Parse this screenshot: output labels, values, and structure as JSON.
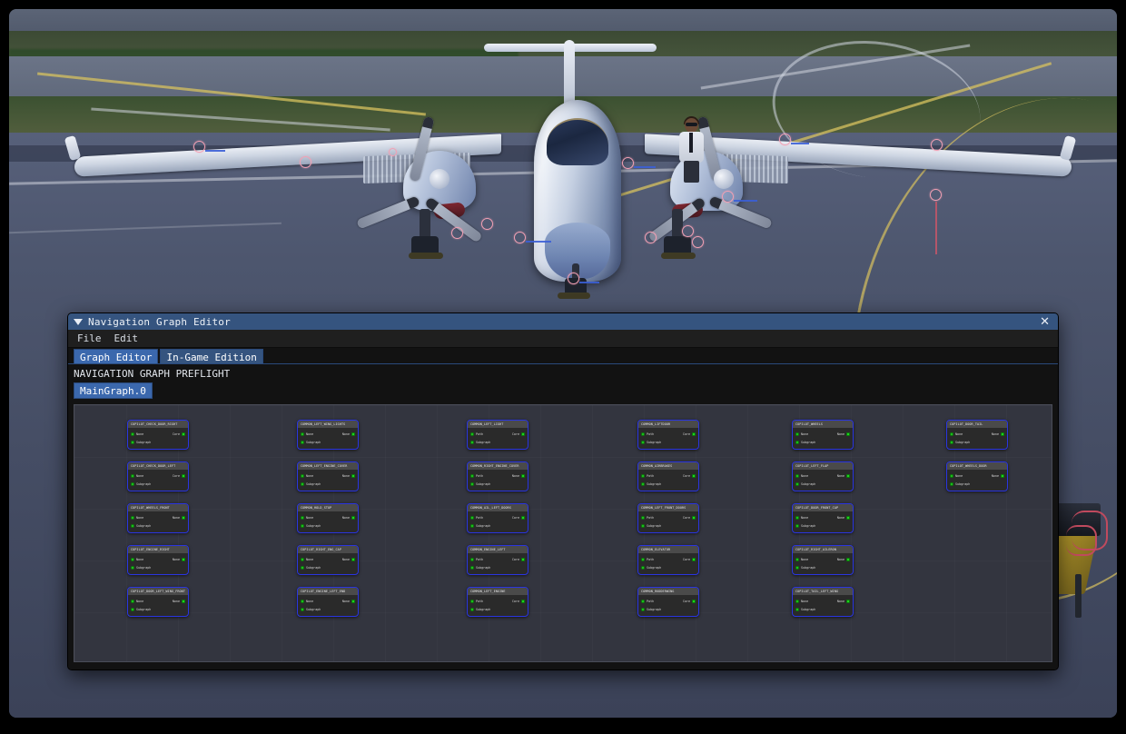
{
  "scene": {
    "description": "Microsoft Flight Simulator — twin turboprop aircraft on apron with preflight inspection markers",
    "aircraft": "twin-turboprop",
    "ground_crew": "pilot-figure",
    "ground_equipment": "gpu-cart"
  },
  "window": {
    "title": "Navigation Graph Editor",
    "collapse_icon": "triangle-down-icon",
    "close_icon": "close-icon",
    "close_label": "✕"
  },
  "menubar": {
    "items": [
      {
        "label": "File"
      },
      {
        "label": "Edit"
      }
    ]
  },
  "tabs": [
    {
      "label": "Graph Editor",
      "active": true
    },
    {
      "label": "In-Game Edition",
      "active": false
    }
  ],
  "graph_header": "NAVIGATION GRAPH PREFLIGHT",
  "graph_tabs": [
    {
      "label": "MainGraph.0",
      "active": true
    }
  ],
  "colors": {
    "titlebar": "#35547f",
    "tab_active": "#3b68ad",
    "canvas_bg": "#33353f",
    "node_border": "#2a35e0",
    "node_header": "#4a4a4a",
    "port_green": "#1fd21f",
    "window_bg": "#1c1c1c"
  },
  "canvas": {
    "columns": 6,
    "rows": 5,
    "node_rows": [
      {
        "nodes": [
          {
            "title": "COPILOT_CHECK_DOOR_RIGHT",
            "in_port": "exec",
            "in_label": "None",
            "out_label": "Core",
            "out_port": "exec",
            "sub_label": "Subgraph"
          },
          {
            "title": "COMMON_LEFT_WING_LIGHTS",
            "in_port": "exec",
            "in_label": "None",
            "out_label": "None",
            "out_port": "exec",
            "sub_label": "Subgraph"
          },
          {
            "title": "COMMON_LEFT_LIGHT",
            "in_port": "exec",
            "in_label": "Path",
            "out_label": "Core",
            "out_port": "exec",
            "sub_label": "Subgraph"
          },
          {
            "title": "COMMON_LIFTDOOR",
            "in_port": "exec",
            "in_label": "Path",
            "out_label": "Core",
            "out_port": "exec",
            "sub_label": "Subgraph"
          },
          {
            "title": "COPILOT_WHEELS",
            "in_port": "exec",
            "in_label": "None",
            "out_label": "None",
            "out_port": "exec",
            "sub_label": "Subgraph"
          },
          {
            "title": "COPILOT_DOOR_TAIL",
            "in_port": "exec",
            "in_label": "None",
            "out_label": "None",
            "out_port": "exec",
            "sub_label": "Subgraph"
          }
        ]
      },
      {
        "nodes": [
          {
            "title": "COPILOT_CHECK_DOOR_LEFT",
            "in_port": "exec",
            "in_label": "None",
            "out_label": "Core",
            "out_port": "exec",
            "sub_label": "Subgraph"
          },
          {
            "title": "COMMON_LEFT_ENGINE_COVER",
            "in_port": "exec",
            "in_label": "None",
            "out_label": "None",
            "out_port": "exec",
            "sub_label": "Subgraph"
          },
          {
            "title": "COMMON_RIGHT_ENGINE_COVER",
            "in_port": "exec",
            "in_label": "Path",
            "out_label": "None",
            "out_port": "exec",
            "sub_label": "Subgraph"
          },
          {
            "title": "COMMON_AIRBRAKES",
            "in_port": "exec",
            "in_label": "Path",
            "out_label": "Core",
            "out_port": "exec",
            "sub_label": "Subgraph"
          },
          {
            "title": "COPILOT_LEFT_FLAP",
            "in_port": "exec",
            "in_label": "None",
            "out_label": "None",
            "out_port": "exec",
            "sub_label": "Subgraph"
          },
          {
            "title": "COPILOT_WHEELS_DOOR",
            "in_port": "exec",
            "in_label": "None",
            "out_label": "None",
            "out_port": "exec",
            "sub_label": "Subgraph"
          }
        ]
      },
      {
        "nodes": [
          {
            "title": "COPILOT_WHEELS_FRONT",
            "in_port": "exec",
            "in_label": "None",
            "out_label": "None",
            "out_port": "exec",
            "sub_label": "Subgraph"
          },
          {
            "title": "COMMON_HOLD_STOP",
            "in_port": "exec",
            "in_label": "None",
            "out_label": "None",
            "out_port": "exec",
            "sub_label": "Subgraph"
          },
          {
            "title": "COMMON_AIL_LEFT_DOORS",
            "in_port": "exec",
            "in_label": "Path",
            "out_label": "Core",
            "out_port": "exec",
            "sub_label": "Subgraph"
          },
          {
            "title": "COMMON_LEFT_FRONT_DOORS",
            "in_port": "exec",
            "in_label": "Path",
            "out_label": "Core",
            "out_port": "exec",
            "sub_label": "Subgraph"
          },
          {
            "title": "COPILOT_DOOR_FRONT_CAP",
            "in_port": "exec",
            "in_label": "None",
            "out_label": "None",
            "out_port": "exec",
            "sub_label": "Subgraph"
          }
        ]
      },
      {
        "nodes": [
          {
            "title": "COPILOT_ENGINE_RIGHT",
            "in_port": "exec",
            "in_label": "None",
            "out_label": "None",
            "out_port": "exec",
            "sub_label": "Subgraph"
          },
          {
            "title": "COPILOT_RIGHT_ENG_CAP",
            "in_port": "exec",
            "in_label": "None",
            "out_label": "None",
            "out_port": "exec",
            "sub_label": "Subgraph"
          },
          {
            "title": "COMMON_ENGINE_LEFT",
            "in_port": "exec",
            "in_label": "Path",
            "out_label": "Core",
            "out_port": "exec",
            "sub_label": "Subgraph"
          },
          {
            "title": "COMMON_ELEVATOR",
            "in_port": "exec",
            "in_label": "Path",
            "out_label": "Core",
            "out_port": "exec",
            "sub_label": "Subgraph"
          },
          {
            "title": "COPILOT_RIGHT_AILERON",
            "in_port": "exec",
            "in_label": "None",
            "out_label": "None",
            "out_port": "exec",
            "sub_label": "Subgraph"
          }
        ]
      },
      {
        "nodes": [
          {
            "title": "COPILOT_DOOR_LEFT_WING_FRONT",
            "in_port": "exec",
            "in_label": "None",
            "out_label": "None",
            "out_port": "exec",
            "sub_label": "Subgraph"
          },
          {
            "title": "COPILOT_ENGINE_LEFT_END",
            "in_port": "exec",
            "in_label": "None",
            "out_label": "None",
            "out_port": "exec",
            "sub_label": "Subgraph"
          },
          {
            "title": "COMMON_LEFT_ENGINE",
            "in_port": "exec",
            "in_label": "Path",
            "out_label": "Core",
            "out_port": "exec",
            "sub_label": "Subgraph"
          },
          {
            "title": "COMMON_RUDDERWING",
            "in_port": "exec",
            "in_label": "Path",
            "out_label": "Core",
            "out_port": "exec",
            "sub_label": "Subgraph"
          },
          {
            "title": "COPILOT_TAIL_LEFT_WING",
            "in_port": "exec",
            "in_label": "None",
            "out_label": "None",
            "out_port": "exec",
            "sub_label": "Subgraph"
          }
        ]
      }
    ]
  }
}
